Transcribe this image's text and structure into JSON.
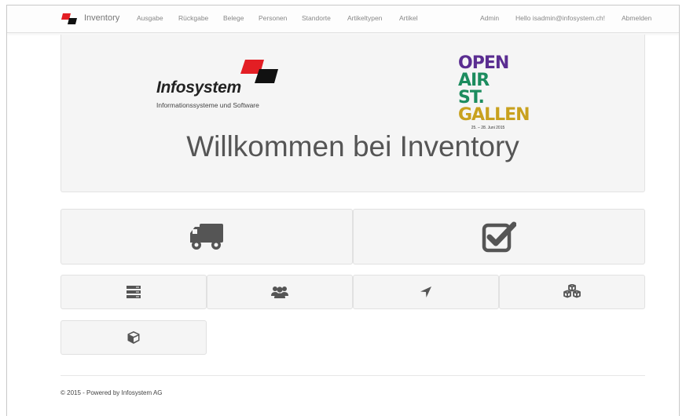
{
  "navbar": {
    "brand": "Inventory",
    "left_items": [
      {
        "label": "Ausgabe"
      },
      {
        "label": "Rückgabe"
      },
      {
        "label": "Belege"
      },
      {
        "label": "Personen"
      },
      {
        "label": "Standorte"
      },
      {
        "label": "Artikeltypen"
      },
      {
        "label": "Artikel"
      }
    ],
    "right_items": [
      {
        "label": "Admin"
      },
      {
        "label": "Hello isadmin@infosystem.ch!"
      },
      {
        "label": "Abmelden"
      }
    ]
  },
  "jumbotron": {
    "heading": "Willkommen bei Inventory",
    "infosystem_logo": {
      "name": "Infosystem",
      "tagline": "Informationssysteme und Software"
    },
    "openair_logo": {
      "lines": [
        "OPEN",
        "AIR ST.",
        "GALLEN"
      ],
      "date": "25. – 28. Juni 2015"
    }
  },
  "tiles": [
    {
      "name": "ausgabe-tile",
      "icon": "truck-icon"
    },
    {
      "name": "rueckgabe-tile",
      "icon": "checkbox-check-icon"
    },
    {
      "name": "belege-tile",
      "icon": "server-list-icon"
    },
    {
      "name": "personen-tile",
      "icon": "users-icon"
    },
    {
      "name": "standorte-tile",
      "icon": "location-arrow-icon"
    },
    {
      "name": "artikeltypen-tile",
      "icon": "cubes-icon"
    },
    {
      "name": "artikel-tile",
      "icon": "cube-icon"
    }
  ],
  "footer": {
    "text": "© 2015 - Powered by Infosystem AG"
  },
  "colors": {
    "brand_red": "#e31e24",
    "brand_black": "#111111",
    "tile_bg": "#f5f5f5",
    "icon_gray": "#555555"
  }
}
